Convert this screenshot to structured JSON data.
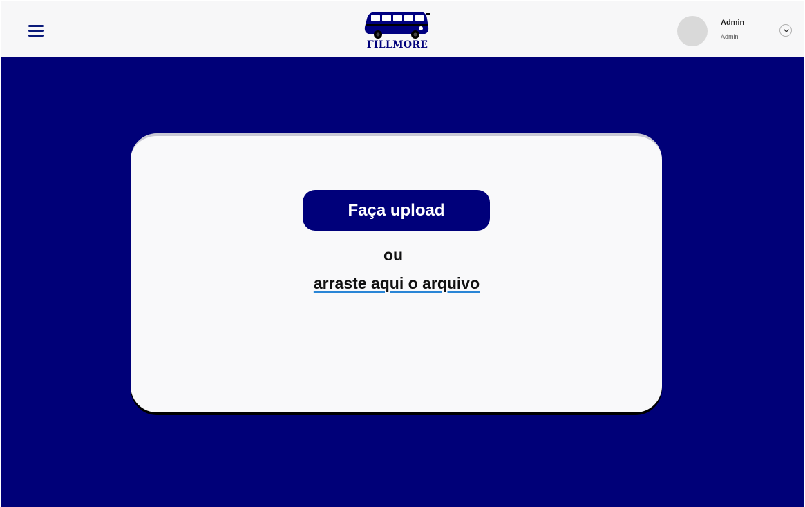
{
  "header": {
    "logo_text": "FILLMORE",
    "user": {
      "name": "Admin",
      "role": "Admin"
    }
  },
  "upload": {
    "button_label": "Faça upload",
    "or_text": "ou",
    "drop_text": "arraste aqui o arquivo"
  },
  "colors": {
    "background": "#000078",
    "header_bg": "#f7f7f8",
    "card_bg": "#f9f9fa",
    "primary": "#00007a",
    "link_underline": "#2a86d6"
  },
  "icons": {
    "menu": "hamburger-menu-icon",
    "logo": "van-bus-icon",
    "dropdown": "chevron-down-icon"
  }
}
